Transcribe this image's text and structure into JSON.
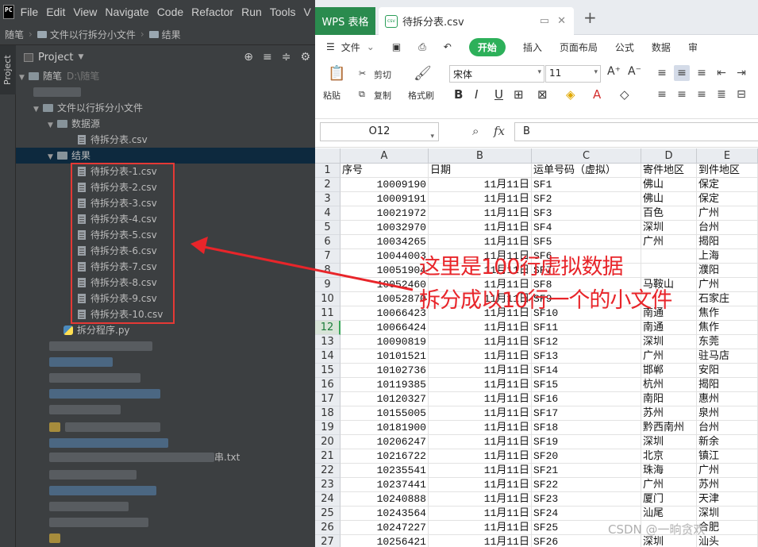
{
  "ide": {
    "logo": "PC",
    "menu": [
      "File",
      "Edit",
      "View",
      "Navigate",
      "Code",
      "Refactor",
      "Run",
      "Tools",
      "V"
    ],
    "breadcrumb": [
      "随笔",
      "文件以行拆分小文件",
      "结果"
    ],
    "side_tab": "Project",
    "project_title": "Project",
    "tree": {
      "root": "随笔",
      "root_path": "D:\\随笔",
      "folder": "文件以行拆分小文件",
      "data_folder": "数据源",
      "source_file": "待拆分表.csv",
      "result_folder": "结果",
      "result_files": [
        "待拆分表-1.csv",
        "待拆分表-2.csv",
        "待拆分表-3.csv",
        "待拆分表-4.csv",
        "待拆分表-5.csv",
        "待拆分表-6.csv",
        "待拆分表-7.csv",
        "待拆分表-8.csv",
        "待拆分表-9.csv",
        "待拆分表-10.csv"
      ],
      "script": "拆分程序.py",
      "partial_file": "串.txt"
    }
  },
  "wps": {
    "brand": "WPS 表格",
    "doc_tab": "待拆分表.csv",
    "csv_badge": "csv",
    "menu": {
      "file": "文件",
      "start": "开始",
      "tabs": [
        "插入",
        "页面布局",
        "公式",
        "数据",
        "审"
      ]
    },
    "ribbon": {
      "paste": "粘贴",
      "cut": "剪切",
      "copy": "复制",
      "format_painter": "格式刷",
      "font_name": "宋体",
      "font_size": "11"
    },
    "name_box": "O12",
    "fx": "fx",
    "formula_value": "B",
    "columns": [
      "A",
      "B",
      "C",
      "D",
      "E"
    ],
    "headers": [
      "序号",
      "日期",
      "运单号码（虚拟）",
      "寄件地区",
      "到件地区"
    ],
    "active_row": 12,
    "rows": [
      [
        "10009190",
        "11月11日",
        "SF1",
        "佛山",
        "保定"
      ],
      [
        "10009191",
        "11月11日",
        "SF2",
        "佛山",
        "保定"
      ],
      [
        "10021972",
        "11月11日",
        "SF3",
        "百色",
        "广州"
      ],
      [
        "10032970",
        "11月11日",
        "SF4",
        "深圳",
        "台州"
      ],
      [
        "10034265",
        "11月11日",
        "SF5",
        "广州",
        "揭阳"
      ],
      [
        "10044003",
        "11月11日",
        "SF6",
        "",
        "上海"
      ],
      [
        "10051904",
        "11月11日",
        "SF7",
        "",
        "濮阳"
      ],
      [
        "10052460",
        "11月11日",
        "SF8",
        "马鞍山",
        "广州"
      ],
      [
        "10052870",
        "11月11日",
        "SF9",
        "",
        "石家庄"
      ],
      [
        "10066423",
        "11月11日",
        "SF10",
        "南通",
        "焦作"
      ],
      [
        "10066424",
        "11月11日",
        "SF11",
        "南通",
        "焦作"
      ],
      [
        "10090819",
        "11月11日",
        "SF12",
        "深圳",
        "东莞"
      ],
      [
        "10101521",
        "11月11日",
        "SF13",
        "广州",
        "驻马店"
      ],
      [
        "10102736",
        "11月11日",
        "SF14",
        "邯郸",
        "安阳"
      ],
      [
        "10119385",
        "11月11日",
        "SF15",
        "杭州",
        "揭阳"
      ],
      [
        "10120327",
        "11月11日",
        "SF16",
        "南阳",
        "惠州"
      ],
      [
        "10155005",
        "11月11日",
        "SF17",
        "苏州",
        "泉州"
      ],
      [
        "10181900",
        "11月11日",
        "SF18",
        "黔西南州",
        "台州"
      ],
      [
        "10206247",
        "11月11日",
        "SF19",
        "深圳",
        "新余"
      ],
      [
        "10216722",
        "11月11日",
        "SF20",
        "北京",
        "镇江"
      ],
      [
        "10235541",
        "11月11日",
        "SF21",
        "珠海",
        "广州"
      ],
      [
        "10237441",
        "11月11日",
        "SF22",
        "广州",
        "苏州"
      ],
      [
        "10240888",
        "11月11日",
        "SF23",
        "厦门",
        "天津"
      ],
      [
        "10243564",
        "11月11日",
        "SF24",
        "汕尾",
        "深圳"
      ],
      [
        "10247227",
        "11月11日",
        "SF25",
        "",
        "合肥"
      ],
      [
        "10256421",
        "11月11日",
        "SF26",
        "深圳",
        "汕头"
      ]
    ]
  },
  "annotation": {
    "line1": "这里是100行虚拟数据",
    "line2": "拆分成以10行一个的小文件",
    "color": "#e8252a"
  },
  "watermark": "CSDN @一晌贪欢"
}
